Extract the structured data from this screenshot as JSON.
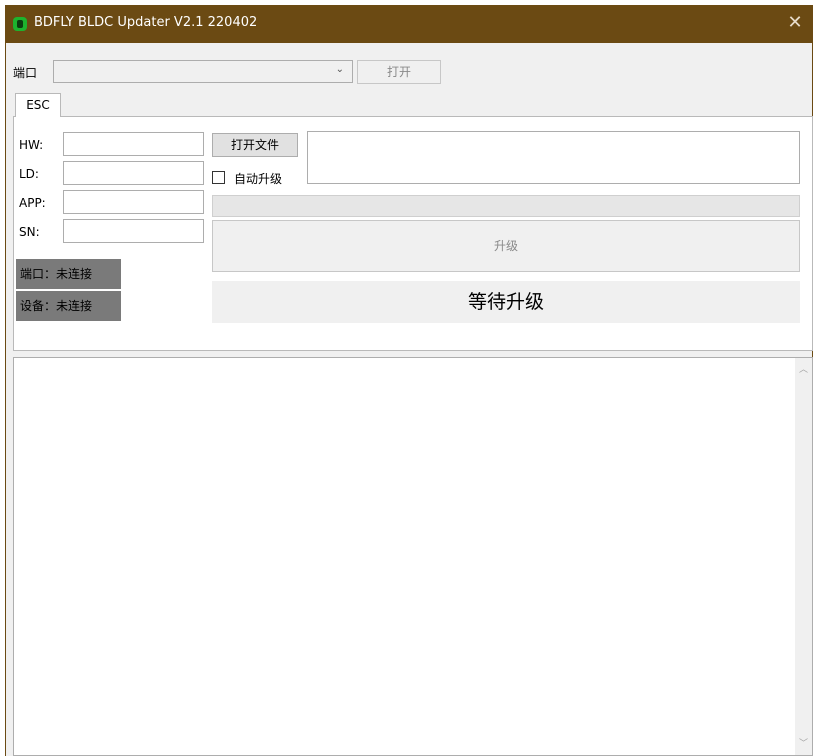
{
  "window": {
    "title": "BDFLY BLDC Updater V2.1 220402",
    "close_glyph": "✕",
    "titlebar_color": "#6b4a13"
  },
  "port_row": {
    "label": "端口",
    "combo_value": "",
    "open_button": "打开"
  },
  "tabs": [
    {
      "label": "ESC",
      "selected": true
    }
  ],
  "esc": {
    "fields": [
      {
        "label": "HW:",
        "value": ""
      },
      {
        "label": "LD:",
        "value": ""
      },
      {
        "label": "APP:",
        "value": ""
      },
      {
        "label": "SN:",
        "value": ""
      }
    ],
    "open_file_button": "打开文件",
    "auto_upgrade_label": "自动升级",
    "auto_upgrade_checked": false,
    "file_path": "",
    "progress": 0,
    "upgrade_button": "升级",
    "port_status": "端口：未连接",
    "device_status": "设备：未连接",
    "big_status": "等待升级"
  },
  "log": {
    "text": ""
  }
}
